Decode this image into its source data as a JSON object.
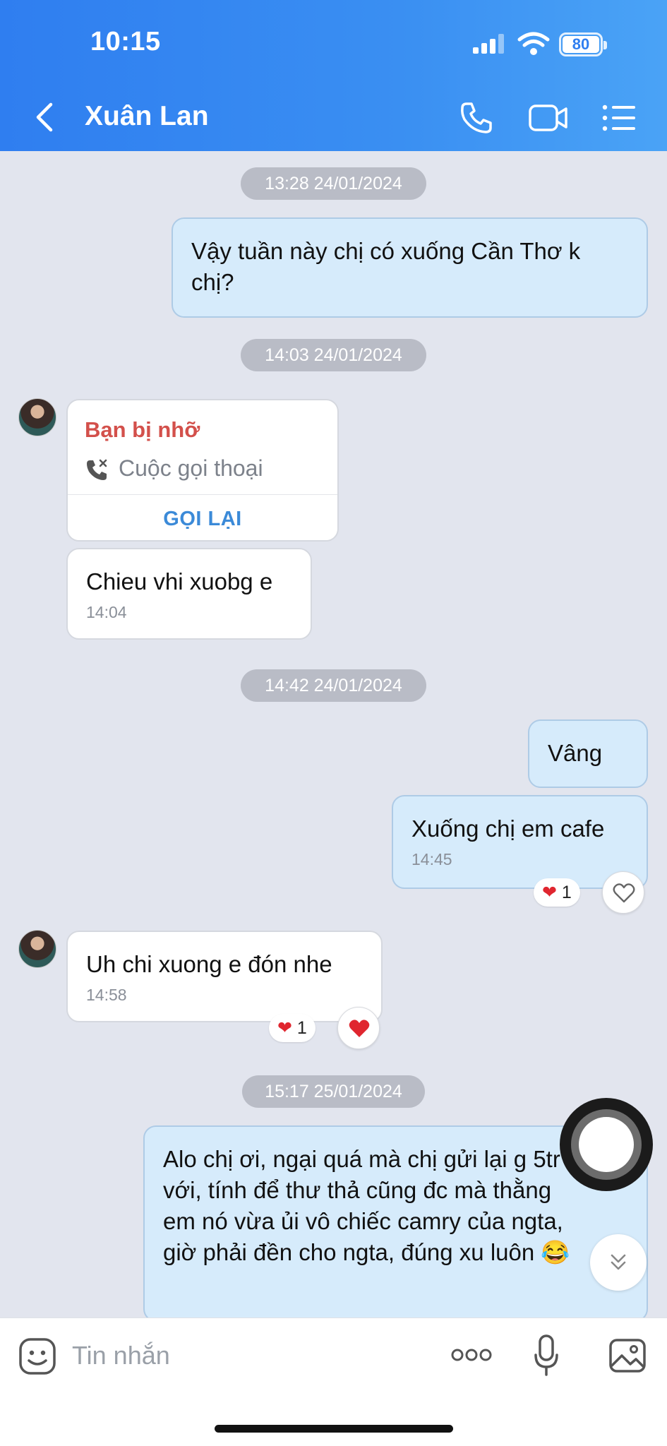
{
  "status_bar": {
    "time": "10:15",
    "battery": "80"
  },
  "header": {
    "contact_name": "Xuân Lan"
  },
  "chat": {
    "dates": [
      "13:28 24/01/2024",
      "14:03 24/01/2024",
      "14:42 24/01/2024",
      "15:17 25/01/2024"
    ],
    "messages": [
      {
        "text": "Vậy tuần này chị có xuống Cần Thơ k chị?"
      },
      {
        "text": "Chieu vhi xuobg e",
        "time": "14:04"
      },
      {
        "text": "Vâng"
      },
      {
        "text": "Xuống chị em cafe",
        "time": "14:45",
        "reaction_count": "1"
      },
      {
        "text": "Uh chi xuong e đón nhe",
        "time": "14:58",
        "reaction_count": "1"
      },
      {
        "text": "Alo chị ơi, ngại quá mà chị gửi lại g 5tr với, tính để thư thả cũng đc mà thằng em nó vừa ủi vô chiếc camry của ngta, giờ phải đền cho ngta, đúng xu luôn 😂"
      }
    ],
    "missed_call": {
      "title": "Bạn bị nhỡ",
      "type": "Cuộc gọi thoại",
      "action": "GỌI LẠI"
    }
  },
  "input": {
    "placeholder": "Tin nhắn"
  },
  "colors": {
    "header": "#2f7ef0",
    "outgoing_bubble": "#d6ebfb",
    "missed": "#d3504b",
    "link": "#3b8ad8",
    "heart": "#e0262f"
  },
  "icons": [
    "back-icon",
    "phone-icon",
    "video-icon",
    "menu-icon",
    "sticker-icon",
    "more-icon",
    "mic-icon",
    "image-icon",
    "heart-icon",
    "chevron-down-icon"
  ]
}
